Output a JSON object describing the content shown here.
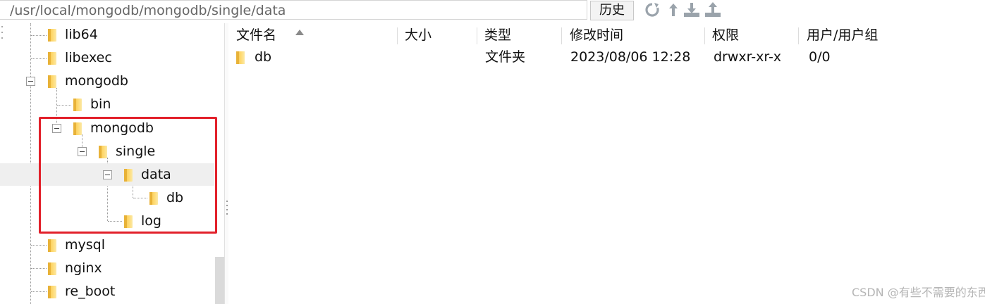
{
  "pathbar": {
    "path": "/usr/local/mongodb/mongodb/single/data",
    "history_label": "历史"
  },
  "toolbar": {
    "icons": [
      "refresh-icon",
      "up-arrow-icon",
      "download-icon",
      "upload-icon"
    ]
  },
  "tree": {
    "items": [
      {
        "label": "lib64"
      },
      {
        "label": "libexec"
      },
      {
        "label": "mongodb"
      },
      {
        "label": "bin"
      },
      {
        "label": "mongodb"
      },
      {
        "label": "single"
      },
      {
        "label": "data"
      },
      {
        "label": "db"
      },
      {
        "label": "log"
      },
      {
        "label": "mysql"
      },
      {
        "label": "nginx"
      },
      {
        "label": "re_boot"
      }
    ],
    "selected": "data",
    "highlight_color": "#e2202a"
  },
  "filelist": {
    "columns": [
      "文件名",
      "大小",
      "类型",
      "修改时间",
      "权限",
      "用户/用户组"
    ],
    "rows": [
      {
        "name": "db",
        "size": "",
        "type": "文件夹",
        "modified": "2023/08/06 12:28",
        "permissions": "drwxr-xr-x",
        "owner": "0/0"
      }
    ]
  },
  "watermark": "CSDN @有些不需要的东西"
}
